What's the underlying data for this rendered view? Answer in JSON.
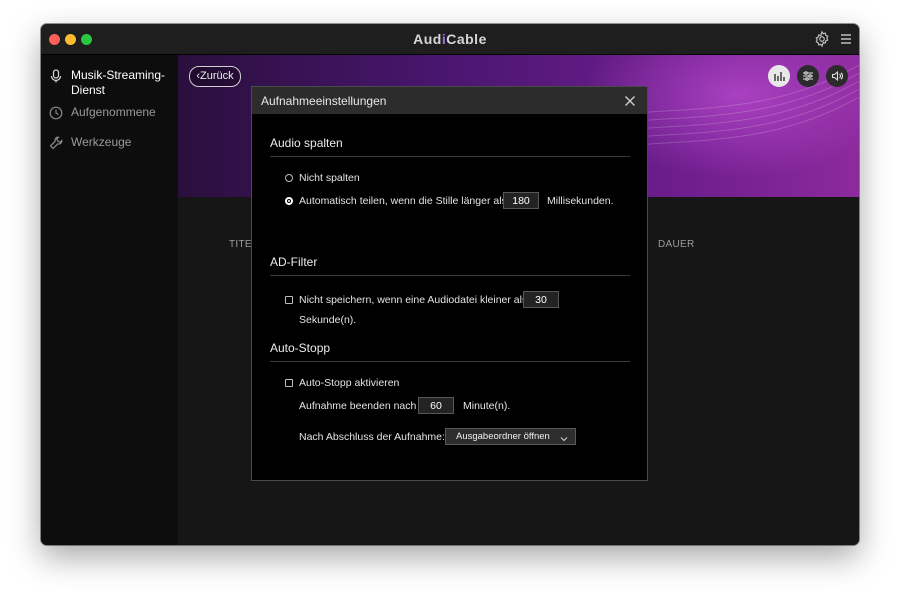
{
  "app": {
    "title_prefix": "Aud",
    "title_accent": "i",
    "title_suffix": "Cable"
  },
  "titlebar_icons": {
    "settings": "gear-icon",
    "menu": "hamburger-icon"
  },
  "sidebar": {
    "items": [
      {
        "label": "Musik-Streaming-Dienst",
        "icon": "microphone-icon",
        "active": true
      },
      {
        "label": "Aufgenommene",
        "icon": "clock-icon",
        "active": false
      },
      {
        "label": "Werkzeuge",
        "icon": "wrench-icon",
        "active": false
      }
    ]
  },
  "main": {
    "back_label": "Zurück",
    "toolbar_icons": [
      "equalizer-icon",
      "sliders-icon",
      "volume-icon"
    ],
    "columns": {
      "title": "TITEL",
      "duration": "DAUER"
    }
  },
  "dialog": {
    "title": "Aufnahmeeinstellungen",
    "audio_split": {
      "heading": "Audio spalten",
      "option_no_split": "Nicht spalten",
      "option_auto_split": "Automatisch teilen, wenn die Stille länger als",
      "silence_value": "180",
      "silence_unit": "Millisekunden.",
      "selected": "auto"
    },
    "ad_filter": {
      "heading": "AD-Filter",
      "option_label": "Nicht speichern, wenn eine Audiodatei kleiner als",
      "size_value": "30",
      "size_unit": "Sekunde(n).",
      "checked": false
    },
    "auto_stop": {
      "heading": "Auto-Stopp",
      "enable_label": "Auto-Stopp aktivieren",
      "checked": false,
      "end_after_label": "Aufnahme beenden nach",
      "end_after_value": "60",
      "end_after_unit": "Minute(n).",
      "after_label": "Nach Abschluss der Aufnahme:",
      "after_value": "Ausgabeordner öffnen"
    }
  }
}
